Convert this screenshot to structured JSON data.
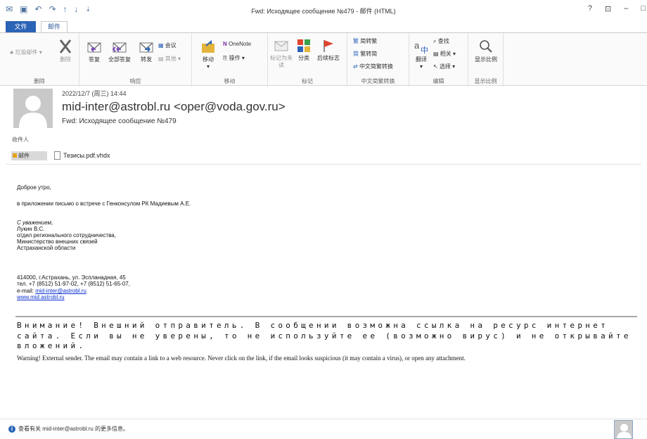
{
  "window": {
    "title": "Fwd: Исходящее сообщение №479 - 邮件 (HTML)",
    "controls": [
      "?",
      "⊡",
      "–",
      "□"
    ]
  },
  "tabs": {
    "file": "文件",
    "mail": "邮件"
  },
  "ribbon": {
    "groups": {
      "delete": "删除",
      "respond": "响应",
      "move": "移动",
      "tags": "标记",
      "convert": "中文简繁转换",
      "edit": "编辑",
      "zoom_group": "显示比例"
    },
    "junk": "垃圾邮件",
    "delete": "删除",
    "reply": "答复",
    "reply_all": "全部答复",
    "forward": "转发",
    "meeting": "会议",
    "more": "其他",
    "move": "移动",
    "onenote": "OneNote",
    "actions": "操作",
    "mark_unread": "标记为未读",
    "categorize": "分类",
    "follow_up": "后续标志",
    "to_traditional": "简转繁",
    "to_simplified": "繁转简",
    "convert": "中文简繁转换",
    "translate": "翻译",
    "find": "查找",
    "related": "相关",
    "select": "选择",
    "zoom": "显示比例"
  },
  "message": {
    "date": "2022/12/7 (周三) 14:44",
    "sender": "mid-inter@astrobl.ru <oper@voda.gov.ru>",
    "subject": "Fwd: Исходящее сообщение №479",
    "to_label": "收件人",
    "attachment_mail": "邮件",
    "attachment_file": "Тезисы.pdf.vhdx"
  },
  "body": {
    "greeting": "Доброе утро,",
    "line1": "в приложении письмо о встрече с Генконсулом РК Мадиевым А.Е.",
    "regards": "С уважением,",
    "name": "Лукин В.С.",
    "dept": "отдел регионального сотрудничества,",
    "ministry": "Министерство внешних связей",
    "region": "Астраханской области",
    "address": "414000, г.Астрахань, ул. Эспланадная, 45",
    "phone": "тел. +7 (8512) 51-97-02, +7 (8512) 51-65-07,",
    "email_label": "e-mail: ",
    "email": "mid-inter@astrobl.ru",
    "site": "www.mid.astrobl.ru"
  },
  "warning": {
    "ru": "Внимание! Внешний отправитель. В сообщении возможна ссылка на ресурс интернет сайта. Если вы не уверены, то не используйте ее (возможно вирус) и не открывайте вложений.",
    "en": "Warning! External sender. The email may contain a link to a web resource. Never click on the link, if the email looks suspicious (it may contain a virus), or open any attachment."
  },
  "footer": {
    "info": "查看有关 mid-inter@astrobl.ru 的更多信息。"
  },
  "colors": {
    "accent": "#2b63b6",
    "flag": "#e0442c",
    "link": "#0a2fd0"
  }
}
